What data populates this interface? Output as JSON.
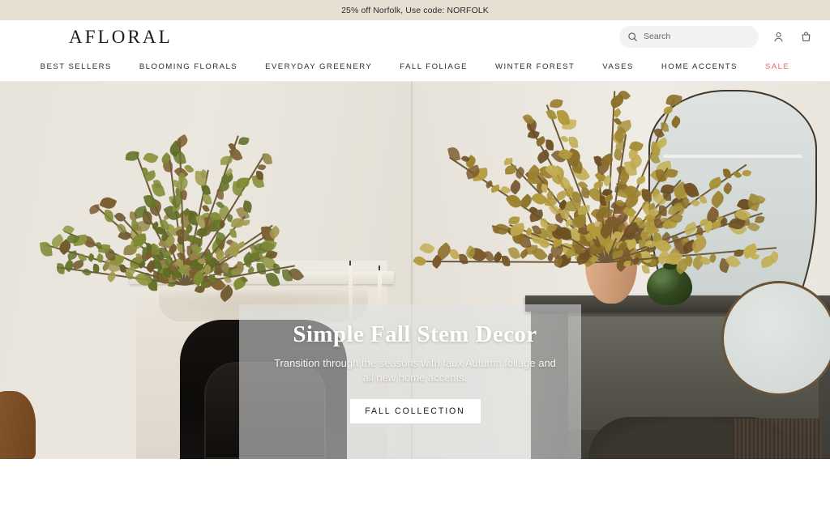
{
  "announcement": {
    "text": "25% off Norfolk, Use code: NORFOLK",
    "background": "#e7dfd2"
  },
  "header": {
    "logo": "AFLORAL",
    "search": {
      "placeholder": "Search",
      "value": "",
      "icon": "search-icon"
    },
    "account_icon": "user-account-icon",
    "cart_icon": "shopping-bag-icon"
  },
  "nav": {
    "items": [
      {
        "label": "BEST SELLERS",
        "highlight": false
      },
      {
        "label": "BLOOMING FLORALS",
        "highlight": false
      },
      {
        "label": "EVERYDAY GREENERY",
        "highlight": false
      },
      {
        "label": "FALL FOLIAGE",
        "highlight": false
      },
      {
        "label": "WINTER FOREST",
        "highlight": false
      },
      {
        "label": "VASES",
        "highlight": false
      },
      {
        "label": "HOME ACCENTS",
        "highlight": false
      },
      {
        "label": "SALE",
        "highlight": true
      }
    ],
    "sale_color": "#f0625c"
  },
  "hero": {
    "title": "Simple Fall Stem Decor",
    "subtitle": "Transition through the seasons with faux Autumn foliage and all new home accents.",
    "cta_label": "FALL COLLECTION",
    "overlay_color": "rgba(225,227,228,0.56)",
    "scene_description": "Two styled mantels with faux autumn foliage in terracotta vases"
  }
}
